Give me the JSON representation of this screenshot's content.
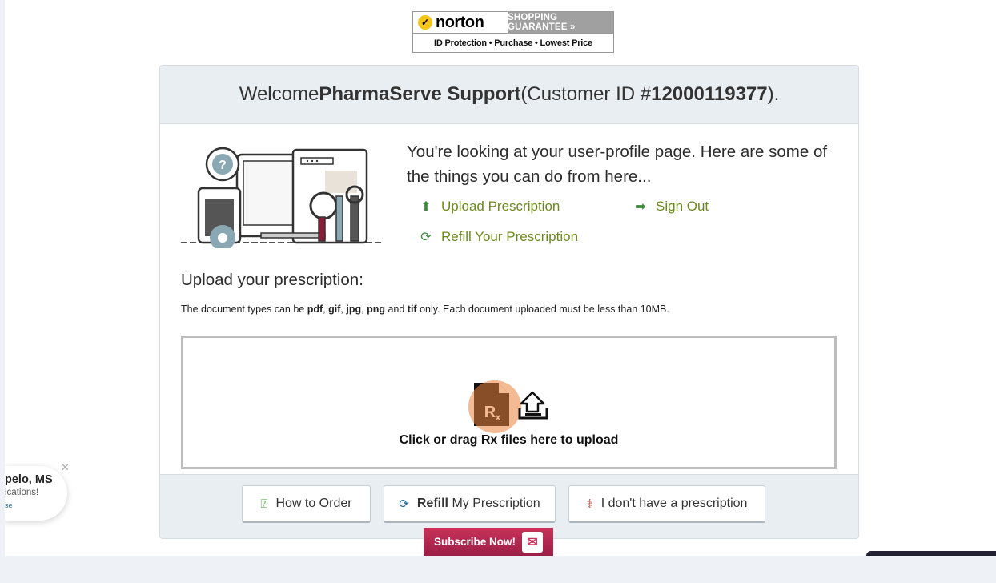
{
  "norton": {
    "brand": "norton",
    "guarantee": "SHOPPING GUARANTEE »",
    "features": "ID Protection  •  Purchase  •  Lowest Price"
  },
  "welcome": {
    "prefix": "Welcome ",
    "name": "PharmaServe Support",
    "mid": " (Customer ID # ",
    "id": "12000119377",
    "suffix": ")."
  },
  "intro": "You're looking at your user-profile page. Here are some of the things you can do from here...",
  "actions": {
    "upload": "Upload Prescription",
    "signout": "Sign Out",
    "refill": "Refill Your Prescription"
  },
  "upload": {
    "title": "Upload your prescription:",
    "note_1": "The document types can be ",
    "t1": "pdf",
    "sep1": ", ",
    "t2": "gif",
    "sep2": ", ",
    "t3": "jpg",
    "sep3": ", ",
    "t4": "png",
    "sep4": " and ",
    "t5": "tif",
    "note_2": " only. Each document uploaded must be less than 10MB.",
    "drop_label": "Click or drag Rx files here to upload"
  },
  "buttons": {
    "how": "How to Order",
    "refill_bold": "Refill",
    "refill_rest": " My Prescription",
    "norx": "I don't have a prescription"
  },
  "subscribe": "Subscribe Now!",
  "popup": {
    "location": "pelo, MS",
    "message": "ications!",
    "small": "se"
  },
  "colors": {
    "accent_green": "#6b8a1c",
    "header_bg": "#e9eef2",
    "subscribe_red": "#b02850"
  }
}
